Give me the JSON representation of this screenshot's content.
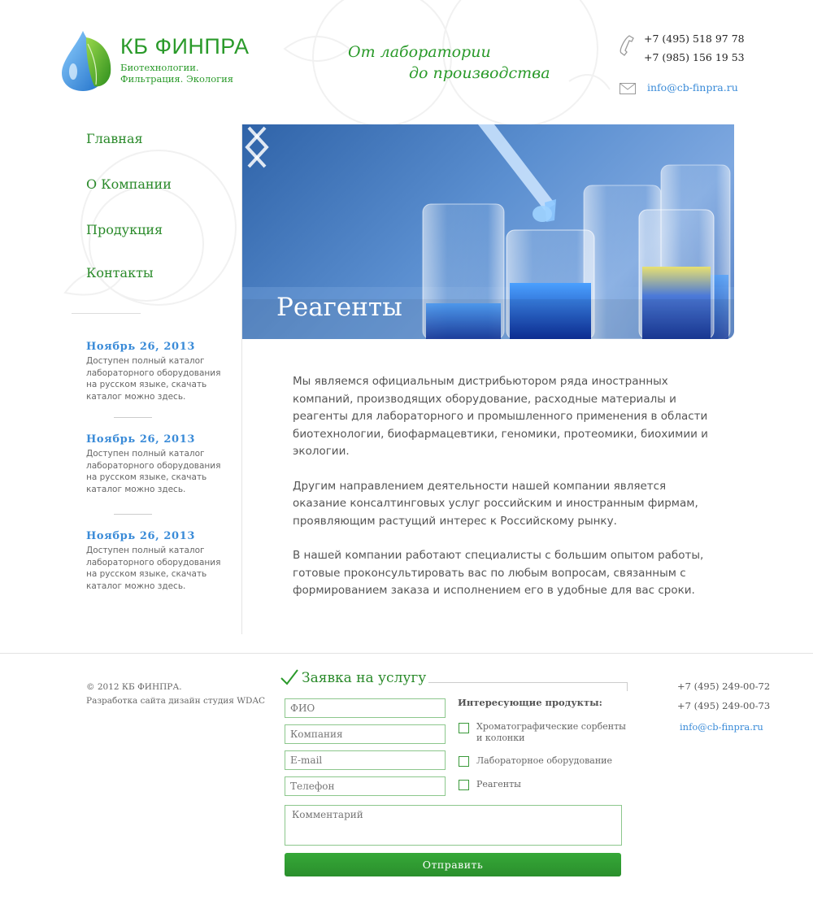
{
  "header": {
    "brand_name": "КБ ФИНПРА",
    "brand_tagline": "Биотехнологии. Фильтрация. Экология",
    "slogan_line1": "От лаборатории",
    "slogan_line2": "до производства",
    "phones": [
      "+7 (495) 518 97 78",
      "+7 (985) 156 19 53"
    ],
    "email": "info@cb-finpra.ru"
  },
  "nav": {
    "items": [
      {
        "label": "Главная"
      },
      {
        "label": "О Компании"
      },
      {
        "label": "Продукция"
      },
      {
        "label": "Контакты"
      }
    ]
  },
  "news": [
    {
      "date": "Ноябрь 26, 2013",
      "text": "Доступен полный каталог лабораторного оборудования на русском языке, скачать каталог можно здесь."
    },
    {
      "date": "Ноябрь 26, 2013",
      "text": "Доступен полный каталог лабораторного оборудования на русском языке, скачать каталог можно здесь."
    },
    {
      "date": "Ноябрь 26, 2013",
      "text": "Доступен полный каталог лабораторного оборудования на русском языке, скачать каталог можно здесь."
    }
  ],
  "slider": {
    "caption": "Реагенты"
  },
  "content": {
    "paragraphs": [
      "Мы являемся официальным дистрибьютором ряда иностранных компаний, производящих оборудование, расходные материалы и реагенты для лабораторного и промышленного применения в области биотехнологии, биофармацевтики, геномики, протеомики, биохимии и экологии.",
      "Другим направлением деятельности нашей компании является оказание консалтинговых услуг российским и иностранным фирмам, проявляющим растущий интерес к Российскому рынку.",
      "В нашей компании работают специалисты с большим опытом работы, готовые проконсультировать вас по любым вопросам, связанным с формированием заказа и исполнением его в удобные для вас сроки."
    ]
  },
  "footer": {
    "copyright": "© 2012 КБ ФИНПРА.",
    "credits": "Разработка сайта дизайн студия WDAC",
    "phones": [
      "+7 (495) 249-00-72",
      "+7 (495) 249-00-73"
    ],
    "email": "info@cb-finpra.ru"
  },
  "form": {
    "title": "Заявка на услугу",
    "placeholders": {
      "name": "ФИО",
      "company": "Компания",
      "email": "E-mail",
      "phone": "Телефон",
      "comment": "Комментарий"
    },
    "products_title": "Интересующие продукты:",
    "products": [
      {
        "label": "Хроматографические сорбенты и колонки"
      },
      {
        "label": "Лабораторное оборудование"
      },
      {
        "label": "Реагенты"
      }
    ],
    "submit_label": "Отправить"
  },
  "colors": {
    "brand_green": "#2a9a2a",
    "link_blue": "#3a8bd8",
    "button_green": "#2e9a30"
  }
}
